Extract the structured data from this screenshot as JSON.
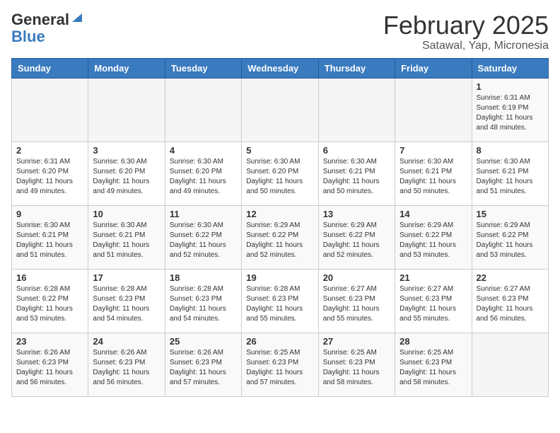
{
  "header": {
    "logo_general": "General",
    "logo_blue": "Blue",
    "month": "February 2025",
    "location": "Satawal, Yap, Micronesia"
  },
  "days_of_week": [
    "Sunday",
    "Monday",
    "Tuesday",
    "Wednesday",
    "Thursday",
    "Friday",
    "Saturday"
  ],
  "weeks": [
    [
      {
        "day": "",
        "sunrise": "",
        "sunset": "",
        "daylight": ""
      },
      {
        "day": "",
        "sunrise": "",
        "sunset": "",
        "daylight": ""
      },
      {
        "day": "",
        "sunrise": "",
        "sunset": "",
        "daylight": ""
      },
      {
        "day": "",
        "sunrise": "",
        "sunset": "",
        "daylight": ""
      },
      {
        "day": "",
        "sunrise": "",
        "sunset": "",
        "daylight": ""
      },
      {
        "day": "",
        "sunrise": "",
        "sunset": "",
        "daylight": ""
      },
      {
        "day": "1",
        "sunrise": "6:31 AM",
        "sunset": "6:19 PM",
        "daylight": "11 hours and 48 minutes."
      }
    ],
    [
      {
        "day": "2",
        "sunrise": "6:31 AM",
        "sunset": "6:20 PM",
        "daylight": "11 hours and 49 minutes."
      },
      {
        "day": "3",
        "sunrise": "6:30 AM",
        "sunset": "6:20 PM",
        "daylight": "11 hours and 49 minutes."
      },
      {
        "day": "4",
        "sunrise": "6:30 AM",
        "sunset": "6:20 PM",
        "daylight": "11 hours and 49 minutes."
      },
      {
        "day": "5",
        "sunrise": "6:30 AM",
        "sunset": "6:20 PM",
        "daylight": "11 hours and 50 minutes."
      },
      {
        "day": "6",
        "sunrise": "6:30 AM",
        "sunset": "6:21 PM",
        "daylight": "11 hours and 50 minutes."
      },
      {
        "day": "7",
        "sunrise": "6:30 AM",
        "sunset": "6:21 PM",
        "daylight": "11 hours and 50 minutes."
      },
      {
        "day": "8",
        "sunrise": "6:30 AM",
        "sunset": "6:21 PM",
        "daylight": "11 hours and 51 minutes."
      }
    ],
    [
      {
        "day": "9",
        "sunrise": "6:30 AM",
        "sunset": "6:21 PM",
        "daylight": "11 hours and 51 minutes."
      },
      {
        "day": "10",
        "sunrise": "6:30 AM",
        "sunset": "6:21 PM",
        "daylight": "11 hours and 51 minutes."
      },
      {
        "day": "11",
        "sunrise": "6:30 AM",
        "sunset": "6:22 PM",
        "daylight": "11 hours and 52 minutes."
      },
      {
        "day": "12",
        "sunrise": "6:29 AM",
        "sunset": "6:22 PM",
        "daylight": "11 hours and 52 minutes."
      },
      {
        "day": "13",
        "sunrise": "6:29 AM",
        "sunset": "6:22 PM",
        "daylight": "11 hours and 52 minutes."
      },
      {
        "day": "14",
        "sunrise": "6:29 AM",
        "sunset": "6:22 PM",
        "daylight": "11 hours and 53 minutes."
      },
      {
        "day": "15",
        "sunrise": "6:29 AM",
        "sunset": "6:22 PM",
        "daylight": "11 hours and 53 minutes."
      }
    ],
    [
      {
        "day": "16",
        "sunrise": "6:28 AM",
        "sunset": "6:22 PM",
        "daylight": "11 hours and 53 minutes."
      },
      {
        "day": "17",
        "sunrise": "6:28 AM",
        "sunset": "6:23 PM",
        "daylight": "11 hours and 54 minutes."
      },
      {
        "day": "18",
        "sunrise": "6:28 AM",
        "sunset": "6:23 PM",
        "daylight": "11 hours and 54 minutes."
      },
      {
        "day": "19",
        "sunrise": "6:28 AM",
        "sunset": "6:23 PM",
        "daylight": "11 hours and 55 minutes."
      },
      {
        "day": "20",
        "sunrise": "6:27 AM",
        "sunset": "6:23 PM",
        "daylight": "11 hours and 55 minutes."
      },
      {
        "day": "21",
        "sunrise": "6:27 AM",
        "sunset": "6:23 PM",
        "daylight": "11 hours and 55 minutes."
      },
      {
        "day": "22",
        "sunrise": "6:27 AM",
        "sunset": "6:23 PM",
        "daylight": "11 hours and 56 minutes."
      }
    ],
    [
      {
        "day": "23",
        "sunrise": "6:26 AM",
        "sunset": "6:23 PM",
        "daylight": "11 hours and 56 minutes."
      },
      {
        "day": "24",
        "sunrise": "6:26 AM",
        "sunset": "6:23 PM",
        "daylight": "11 hours and 56 minutes."
      },
      {
        "day": "25",
        "sunrise": "6:26 AM",
        "sunset": "6:23 PM",
        "daylight": "11 hours and 57 minutes."
      },
      {
        "day": "26",
        "sunrise": "6:25 AM",
        "sunset": "6:23 PM",
        "daylight": "11 hours and 57 minutes."
      },
      {
        "day": "27",
        "sunrise": "6:25 AM",
        "sunset": "6:23 PM",
        "daylight": "11 hours and 58 minutes."
      },
      {
        "day": "28",
        "sunrise": "6:25 AM",
        "sunset": "6:23 PM",
        "daylight": "11 hours and 58 minutes."
      },
      {
        "day": "",
        "sunrise": "",
        "sunset": "",
        "daylight": ""
      }
    ]
  ]
}
